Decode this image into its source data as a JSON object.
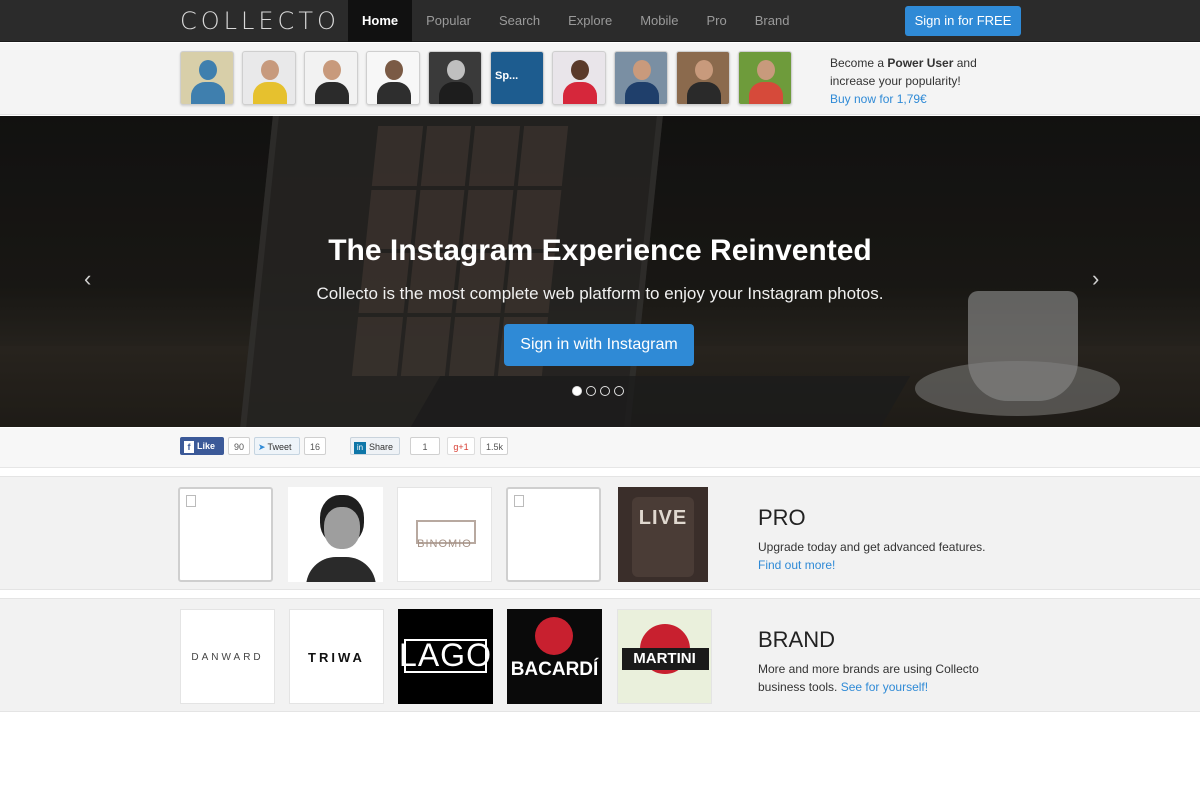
{
  "nav": {
    "logo": "COLLECTO",
    "items": [
      {
        "label": "Home",
        "active": true
      },
      {
        "label": "Popular",
        "active": false
      },
      {
        "label": "Search",
        "active": false
      },
      {
        "label": "Explore",
        "active": false
      },
      {
        "label": "Mobile",
        "active": false
      },
      {
        "label": "Pro",
        "active": false
      },
      {
        "label": "Brand",
        "active": false
      }
    ],
    "signin_label": "Sign in for FREE"
  },
  "power_user": {
    "line1_prefix": "Become a ",
    "line1_bold": "Power User",
    "line1_suffix": " and",
    "line2": "increase your popularity!",
    "link": "Buy now for 1,79€",
    "thumbs": [
      {
        "bg": "#d8cfa9",
        "body": "#3f7fae",
        "head": "#3f7fae"
      },
      {
        "bg": "#e9e9ea",
        "body": "#e6c12e",
        "head": "#c79a7d"
      },
      {
        "bg": "#f2f2f2",
        "body": "#2b2b2b",
        "head": "#c89a7c"
      },
      {
        "bg": "#f7f7f7",
        "body": "#2e2e2e",
        "head": "#7a5a45"
      },
      {
        "bg": "#3a3a3a",
        "body": "#1d1d1d",
        "head": "#bfbfbf"
      },
      {
        "bg": "#1d5c8f",
        "body": "#1d5c8f",
        "head": "#1d5c8f",
        "text": "Sp..."
      },
      {
        "bg": "#e9e5ea",
        "body": "#d6273b",
        "head": "#5a3a2a"
      },
      {
        "bg": "#7a8fa3",
        "body": "#1f3f6b",
        "head": "#c99a7c"
      },
      {
        "bg": "#8b6a4d",
        "body": "#2a2a2a",
        "head": "#c89a7c"
      },
      {
        "bg": "#6e9b3b",
        "body": "#d64a3a",
        "head": "#c89a7c"
      }
    ]
  },
  "hero": {
    "title": "The Instagram Experience Reinvented",
    "subtitle": "Collecto is the most complete web platform to enjoy your Instagram photos.",
    "button": "Sign in with Instagram",
    "prev": "‹",
    "next": "›",
    "slides": 4,
    "active_slide": 1
  },
  "social": {
    "like_label": "Like",
    "like_count": "90",
    "tweet_label": "Tweet",
    "tweet_count": "16",
    "share_label": "Share",
    "share_count": "1",
    "gplus_label": "+1",
    "gplus_count": "1.5k"
  },
  "pro": {
    "title": "PRO",
    "text": "Upgrade today and get advanced features.",
    "link": "Find out more!",
    "tile3_label": "BINOMIO",
    "tile5_label": "LIVE"
  },
  "brand": {
    "title": "BRAND",
    "text_line1": "More and more brands are using Collecto",
    "text_line2_prefix": "business tools. ",
    "link": "See for yourself!",
    "tiles": [
      "DANWARD",
      "TRIWA",
      "LAGO",
      "BACARDÍ",
      "MARTINI"
    ]
  }
}
